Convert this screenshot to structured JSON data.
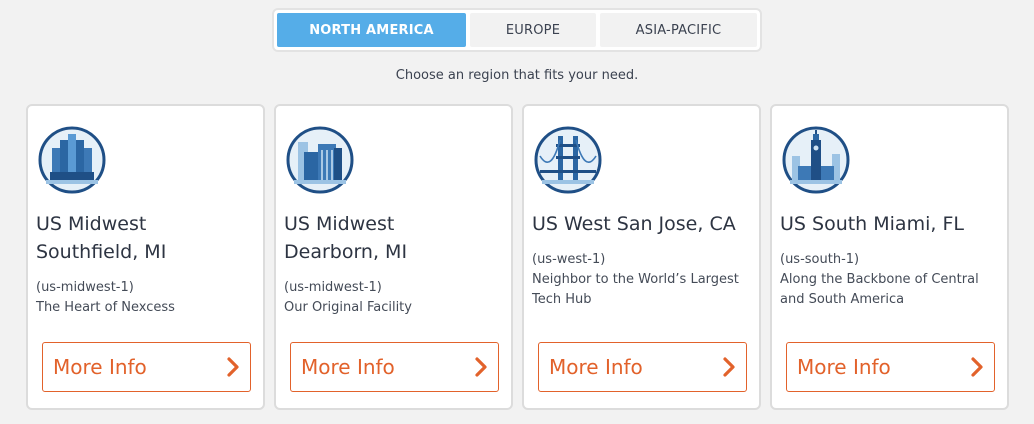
{
  "tabs": [
    {
      "label": "NORTH AMERICA",
      "active": true
    },
    {
      "label": "EUROPE",
      "active": false
    },
    {
      "label": "ASIA-PACIFIC",
      "active": false
    }
  ],
  "subtitle": "Choose an region that fits your need.",
  "cards": [
    {
      "title_line1": "US Midwest",
      "title_line2": "Southfield, MI",
      "code": "(us-midwest-1)",
      "description": "The Heart of Nexcess",
      "button": "More Info",
      "icon": "renaissance-center-icon"
    },
    {
      "title_line1": "US Midwest",
      "title_line2": "Dearborn, MI",
      "code": "(us-midwest-1)",
      "description": "Our Original Facility",
      "button": "More Info",
      "icon": "dearborn-building-icon"
    },
    {
      "title_line1": "US West San Jose, CA",
      "title_line2": "",
      "code": "(us-west-1)",
      "description": "Neighbor to the World’s Largest Tech Hub",
      "button": "More Info",
      "icon": "golden-gate-bridge-icon"
    },
    {
      "title_line1": "US South Miami, FL",
      "title_line2": "",
      "code": "(us-south-1)",
      "description": "Along the Backbone of Central and South America",
      "button": "More Info",
      "icon": "freedom-tower-icon"
    }
  ],
  "colors": {
    "accent": "#55ade8",
    "button": "#e2622b",
    "icon_navy": "#1f4f86",
    "icon_light": "#cfe3f3"
  }
}
